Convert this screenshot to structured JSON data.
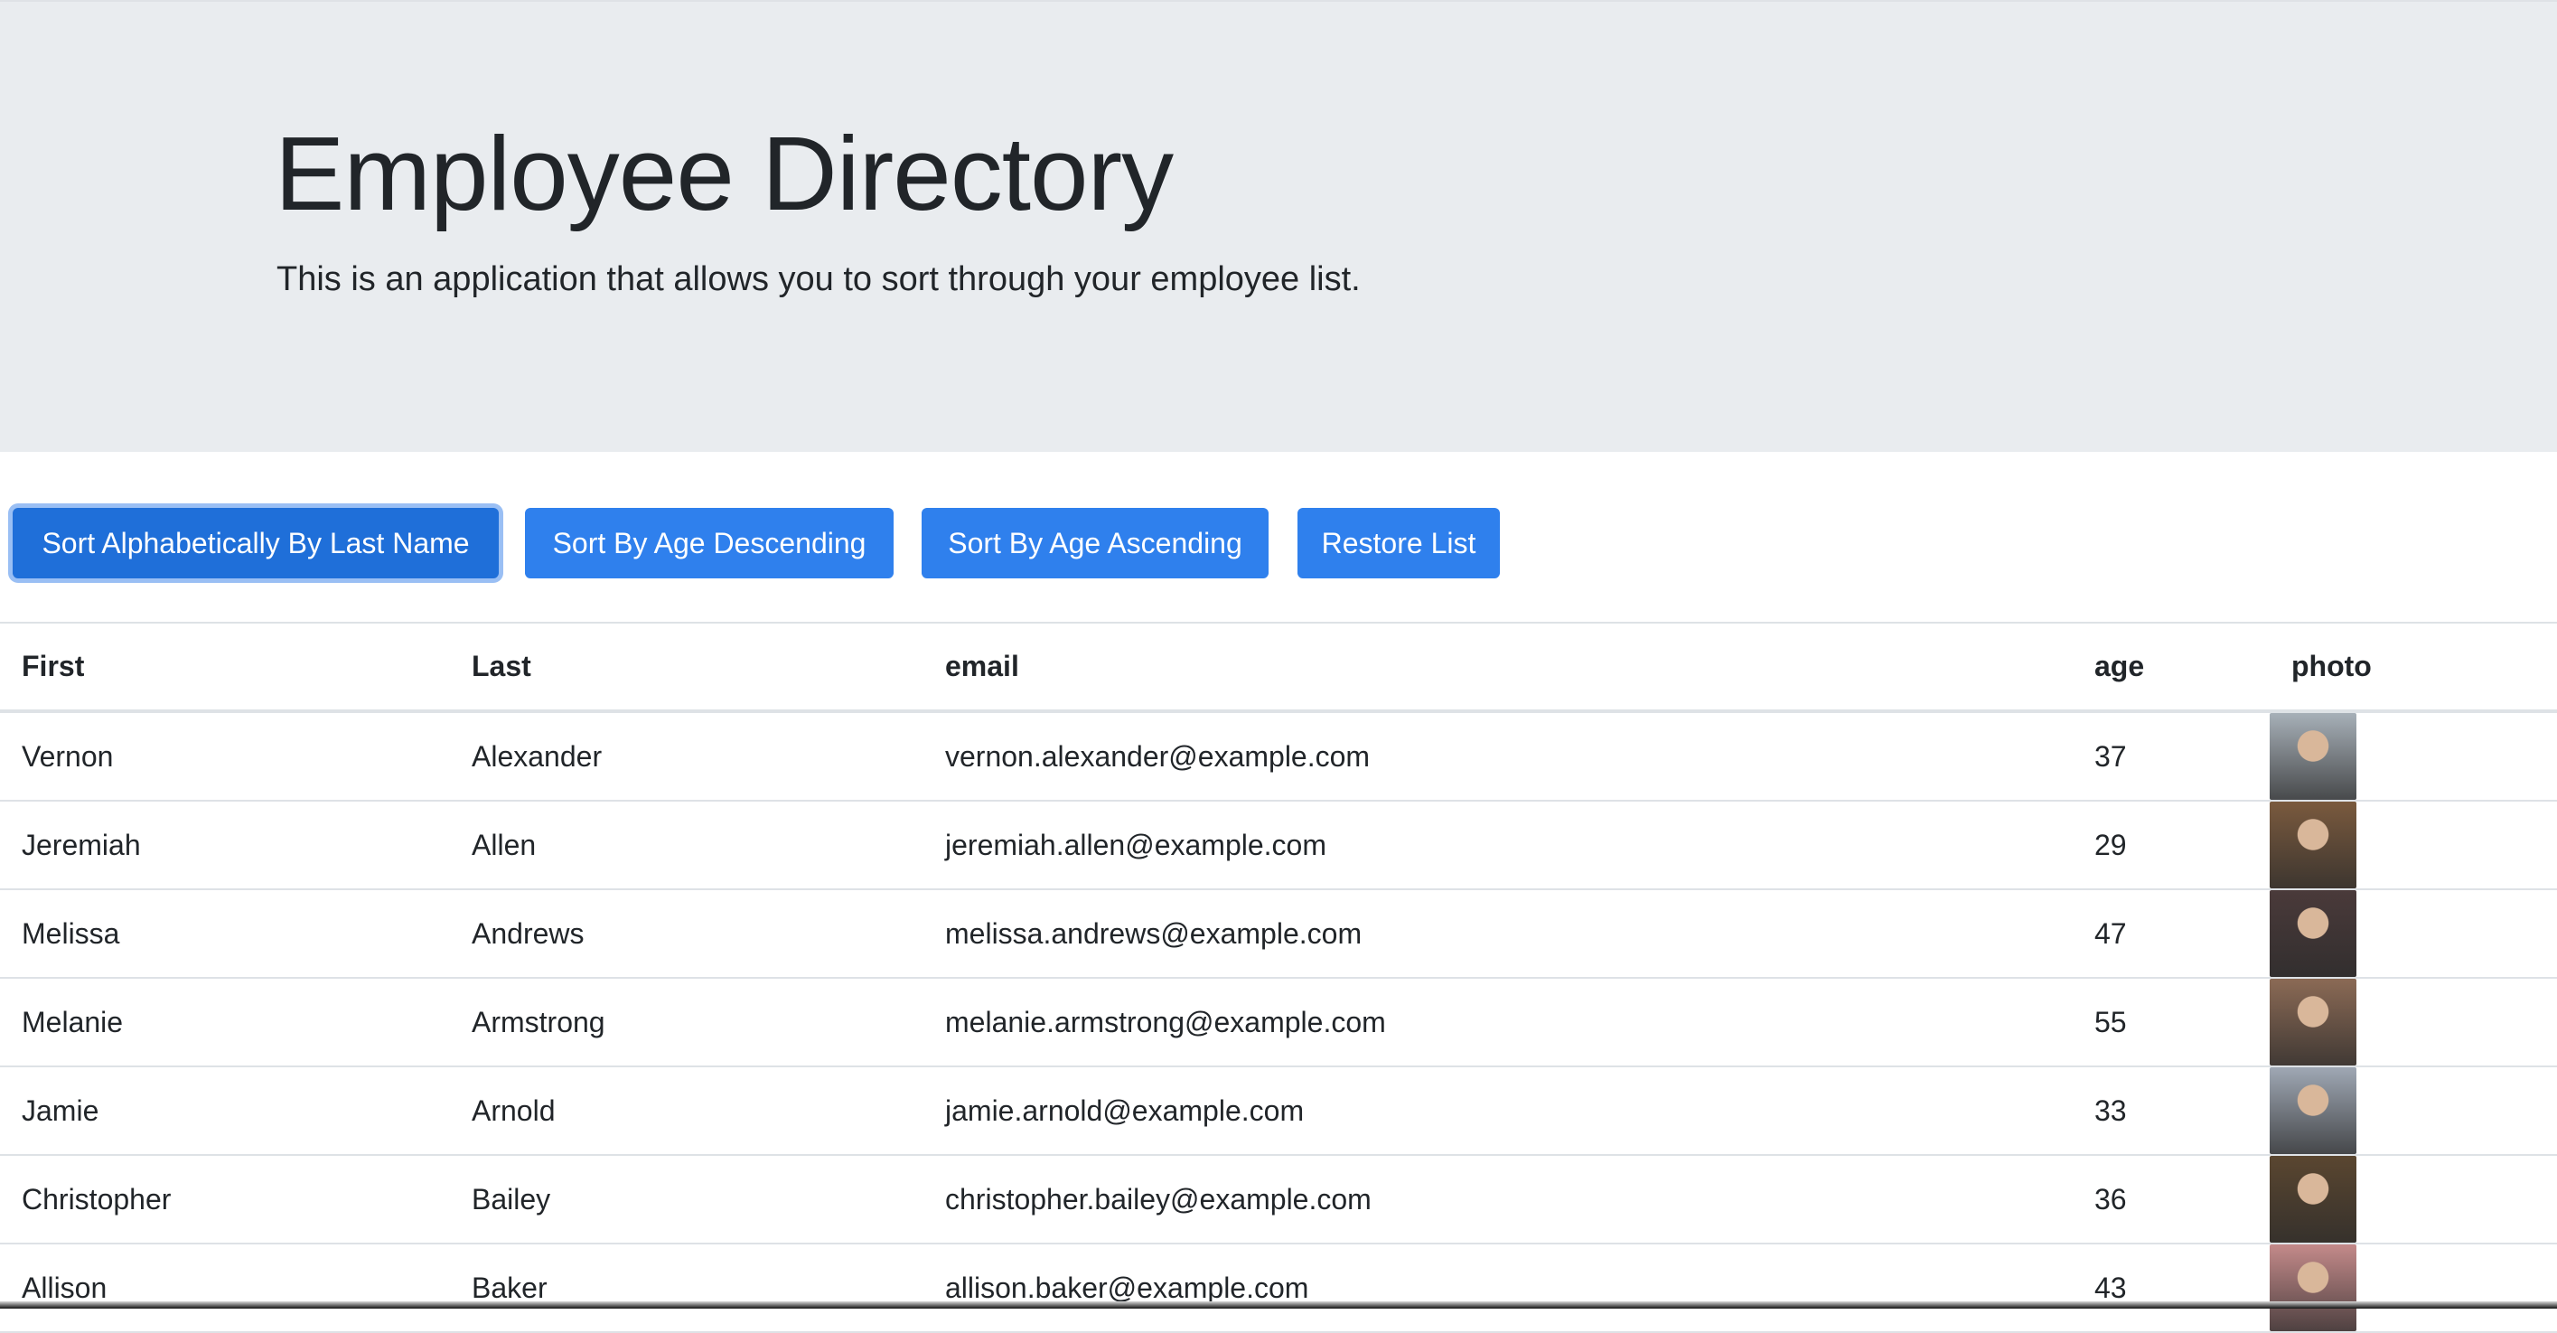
{
  "header": {
    "title": "Employee Directory",
    "subtitle": "This is an application that allows you to sort through your employee list."
  },
  "toolbar": {
    "sort_last_name_label": "Sort Alphabetically By Last Name",
    "sort_age_desc_label": "Sort By Age Descending",
    "sort_age_asc_label": "Sort By Age Ascending",
    "restore_label": "Restore List"
  },
  "table": {
    "columns": [
      "First",
      "Last",
      "email",
      "age",
      "photo"
    ],
    "rows": [
      {
        "first": "Vernon",
        "last": "Alexander",
        "email": "vernon.alexander@example.com",
        "age": "37",
        "photo_tone": "#a7b0b8"
      },
      {
        "first": "Jeremiah",
        "last": "Allen",
        "email": "jeremiah.allen@example.com",
        "age": "29",
        "photo_tone": "#7a5a3e"
      },
      {
        "first": "Melissa",
        "last": "Andrews",
        "email": "melissa.andrews@example.com",
        "age": "47",
        "photo_tone": "#4a3a3a"
      },
      {
        "first": "Melanie",
        "last": "Armstrong",
        "email": "melanie.armstrong@example.com",
        "age": "55",
        "photo_tone": "#8b6a55"
      },
      {
        "first": "Jamie",
        "last": "Arnold",
        "email": "jamie.arnold@example.com",
        "age": "33",
        "photo_tone": "#9fa8b4"
      },
      {
        "first": "Christopher",
        "last": "Bailey",
        "email": "christopher.bailey@example.com",
        "age": "36",
        "photo_tone": "#5a4630"
      },
      {
        "first": "Allison",
        "last": "Baker",
        "email": "allison.baker@example.com",
        "age": "43",
        "photo_tone": "#c48a8a"
      }
    ]
  },
  "colors": {
    "primary": "#2f80ed",
    "jumbotron_bg": "#e9ecef",
    "border": "#dee2e6"
  }
}
